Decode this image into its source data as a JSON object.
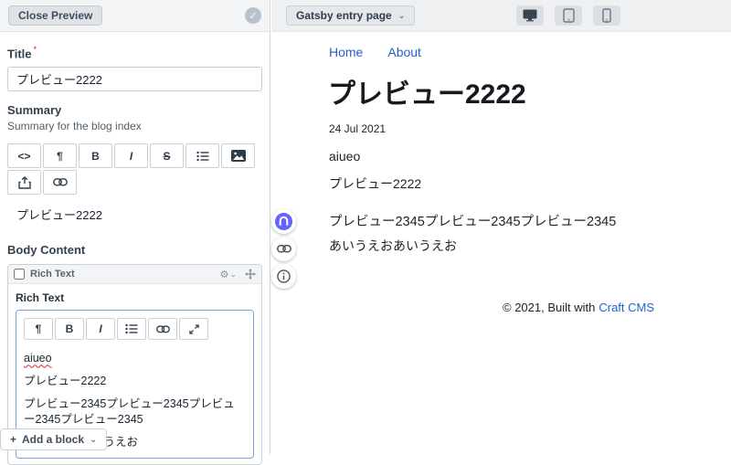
{
  "glyphs": {
    "code": "<>",
    "paragraph": "¶",
    "bold": "B",
    "italic": "I",
    "strike": "S",
    "plus": "+",
    "chevron": "⌄",
    "gear": "⚙",
    "check": "✓"
  },
  "colors": {
    "link_blue": "#2262cc",
    "focus_border": "#71a7db",
    "logo_purple": "#6364ff",
    "required_red": "#cf1124"
  },
  "editor": {
    "header": {
      "close_label": "Close Preview"
    },
    "title_field": {
      "label": "Title",
      "required_mark": "*",
      "value": "プレビュー2222"
    },
    "summary_field": {
      "label": "Summary",
      "instructions": "Summary for the blog index",
      "toolbar_icons": [
        "code",
        "paragraph",
        "bold",
        "italic",
        "strikethrough",
        "bullet-list",
        "image",
        "export",
        "link"
      ],
      "content": "プレビュー2222"
    },
    "body_content": {
      "label": "Body Content",
      "block": {
        "title": "Rich Text",
        "field_label": "Rich Text",
        "toolbar_icons": [
          "paragraph",
          "bold",
          "italic",
          "bullet-list",
          "link",
          "expand"
        ],
        "paragraphs": [
          "aiueo",
          "プレビュー2222",
          "プレビュー2345プレビュー2345プレビュー2345プレビュー2345",
          "あいうえおあいうえお"
        ]
      },
      "add_block_label": "Add a block"
    }
  },
  "preview": {
    "header": {
      "target_label": "Gatsby entry page",
      "devices": [
        "desktop",
        "tablet",
        "phone"
      ]
    },
    "site": {
      "nav": [
        "Home",
        "About"
      ],
      "title": "プレビュー2222",
      "date": "24 Jul 2021",
      "paragraphs": [
        "aiueo",
        "プレビュー2222",
        "プレビュー2345プレビュー2345プレビュー2345",
        "あいうえおあいうえお"
      ],
      "footer_text": "© 2021, Built with",
      "footer_link": "Craft CMS"
    }
  },
  "floating_toolbar": {
    "icons": [
      "logo",
      "copy-link",
      "info"
    ]
  }
}
